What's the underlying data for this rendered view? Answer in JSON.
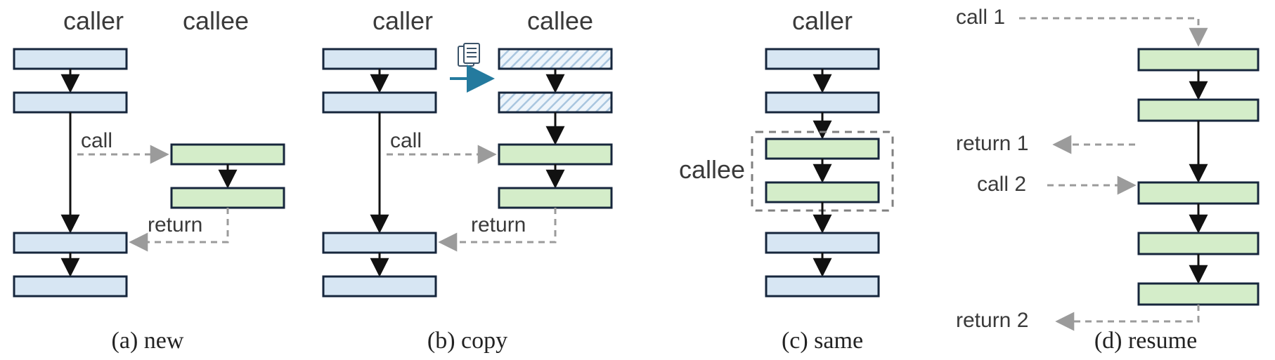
{
  "colors": {
    "caller_fill": "#d7e6f3",
    "callee_fill": "#d4edc9",
    "border": "#16263c",
    "arrow_dark": "#111",
    "arrow_gray": "#9b9b9b",
    "arrow_teal": "#247a9e",
    "dashed_box": "#808080"
  },
  "labels": {
    "caller": "caller",
    "callee": "callee",
    "call": "call",
    "return": "return",
    "call1": "call 1",
    "call2": "call 2",
    "return1": "return 1",
    "return2": "return 2"
  },
  "captions": {
    "a": "(a) new",
    "b": "(b) copy",
    "c": "(c) same",
    "d": "(d) resume"
  },
  "chart_data": [
    {
      "panel": "a",
      "title": "new",
      "caller_blocks": 4,
      "callee_blocks": 2,
      "callee_context": "new (empty)",
      "edges": [
        {
          "from": "caller-2",
          "to": "callee-1",
          "kind": "call",
          "style": "dashed"
        },
        {
          "from": "callee-2",
          "to": "caller-3",
          "kind": "return",
          "style": "dashed"
        }
      ]
    },
    {
      "panel": "b",
      "title": "copy",
      "caller_blocks": 4,
      "callee_blocks": 2,
      "callee_prefix_copied_blocks": 2,
      "callee_context": "copy of caller prefix",
      "edges": [
        {
          "from": "caller-1",
          "to": "callee-copied-1",
          "kind": "copy",
          "style": "solid-teal"
        },
        {
          "from": "caller-2",
          "to": "callee-1",
          "kind": "call",
          "style": "dashed"
        },
        {
          "from": "callee-2",
          "to": "caller-3",
          "kind": "return",
          "style": "dashed"
        }
      ]
    },
    {
      "panel": "c",
      "title": "same",
      "caller_blocks": 4,
      "callee_blocks": 2,
      "callee_context": "shares same stack (inlined)",
      "callee_dashed_group": true
    },
    {
      "panel": "d",
      "title": "resume",
      "callee_blocks": 5,
      "external_events": [
        {
          "kind": "call 1",
          "at": 1,
          "dir": "in"
        },
        {
          "kind": "return 1",
          "at": 2,
          "dir": "out"
        },
        {
          "kind": "call 2",
          "at": 3,
          "dir": "in"
        },
        {
          "kind": "return 2",
          "at": 5,
          "dir": "out"
        }
      ]
    }
  ]
}
